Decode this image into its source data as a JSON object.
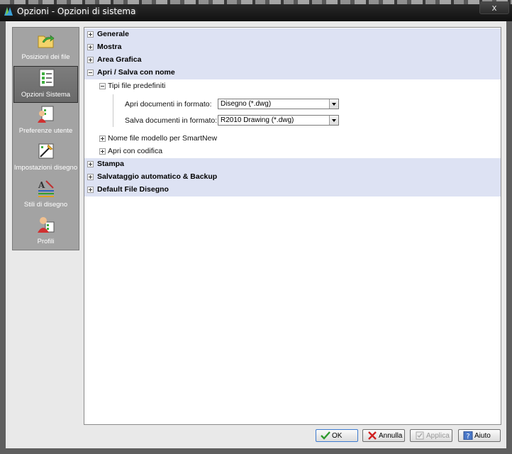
{
  "window": {
    "title": "Opzioni - Opzioni di sistema",
    "close_label": "x"
  },
  "sidebar": {
    "items": [
      {
        "label": "Posizioni dei file",
        "icon": "folder-arrow-icon",
        "selected": false
      },
      {
        "label": "Opzioni Sistema",
        "icon": "system-checklist-icon",
        "selected": true
      },
      {
        "label": "Preferenze utente",
        "icon": "user-preferences-icon",
        "selected": false
      },
      {
        "label": "Impostazioni disegno",
        "icon": "drawing-settings-icon",
        "selected": false
      },
      {
        "label": "Stili di disegno",
        "icon": "drawing-styles-icon",
        "selected": false
      },
      {
        "label": "Profili",
        "icon": "profiles-icon",
        "selected": false
      }
    ]
  },
  "tree": {
    "sections": {
      "generale": "Generale",
      "mostra": "Mostra",
      "area_grafica": "Area Grafica",
      "apri_salva": "Apri / Salva con nome",
      "stampa": "Stampa",
      "salvataggio": "Salvataggio automatico & Backup",
      "default_file": "Default File Disegno"
    },
    "tipi_file": {
      "label": "Tipi file predefiniti",
      "open_label": "Apri documenti in formato:",
      "open_value": "Disegno (*.dwg)",
      "save_label": "Salva documenti in formato:",
      "save_value": "R2010 Drawing (*.dwg)"
    },
    "nome_file_modello": "Nome file modello per SmartNew",
    "apri_con_codifica": "Apri con codifica"
  },
  "buttons": {
    "ok": "OK",
    "annulla": "Annulla",
    "applica": "Applica",
    "aiuto": "Aiuto"
  },
  "colors": {
    "section_bg": "#dde2f3",
    "sidebar_bg": "#a3a3a3",
    "ok_check": "#2e9a2e",
    "cancel_x": "#d02020"
  }
}
